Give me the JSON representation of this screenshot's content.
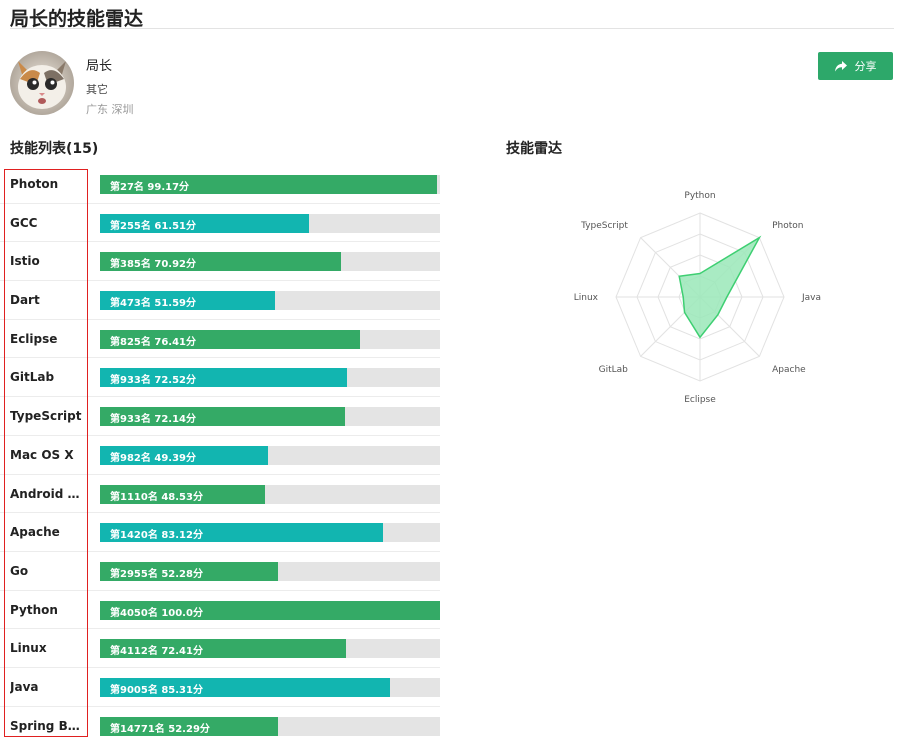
{
  "page": {
    "title": "局长的技能雷达"
  },
  "profile": {
    "name": "局长",
    "role": "其它",
    "location": "广东 深圳",
    "share_label": "分享"
  },
  "sections": {
    "skills_title": "技能列表(15)",
    "radar_title": "技能雷达"
  },
  "colors": {
    "green": "#34aa66",
    "teal": "#12b5b0",
    "highlight": "#e02020"
  },
  "skills": [
    {
      "name": "Photon",
      "label": "第27名 99.17分",
      "score": 99.17,
      "color": "green"
    },
    {
      "name": "GCC",
      "label": "第255名 61.51分",
      "score": 61.51,
      "color": "teal"
    },
    {
      "name": "Istio",
      "label": "第385名 70.92分",
      "score": 70.92,
      "color": "green"
    },
    {
      "name": "Dart",
      "label": "第473名 51.59分",
      "score": 51.59,
      "color": "teal"
    },
    {
      "name": "Eclipse",
      "label": "第825名 76.41分",
      "score": 76.41,
      "color": "green"
    },
    {
      "name": "GitLab",
      "label": "第933名 72.52分",
      "score": 72.52,
      "color": "teal"
    },
    {
      "name": "TypeScript",
      "label": "第933名 72.14分",
      "score": 72.14,
      "color": "green"
    },
    {
      "name": "Mac OS X",
      "label": "第982名 49.39分",
      "score": 49.39,
      "color": "teal"
    },
    {
      "name": "Android St...",
      "label": "第1110名 48.53分",
      "score": 48.53,
      "color": "green"
    },
    {
      "name": "Apache",
      "label": "第1420名 83.12分",
      "score": 83.12,
      "color": "teal"
    },
    {
      "name": "Go",
      "label": "第2955名 52.28分",
      "score": 52.28,
      "color": "green"
    },
    {
      "name": "Python",
      "label": "第4050名 100.0分",
      "score": 100.0,
      "color": "green"
    },
    {
      "name": "Linux",
      "label": "第4112名 72.41分",
      "score": 72.41,
      "color": "green"
    },
    {
      "name": "Java",
      "label": "第9005名 85.31分",
      "score": 85.31,
      "color": "teal"
    },
    {
      "name": "Spring Boot",
      "label": "第14771名 52.29分",
      "score": 52.29,
      "color": "green"
    }
  ],
  "radar": {
    "axes": [
      "Python",
      "Photon",
      "Java",
      "Apache",
      "Eclipse",
      "GitLab",
      "Linux",
      "TypeScript"
    ],
    "values": [
      0.28,
      1.0,
      0.32,
      0.3,
      0.48,
      0.26,
      0.2,
      0.35
    ],
    "fill_color": "#9ae8b8",
    "line_color": "#3ecf72"
  }
}
